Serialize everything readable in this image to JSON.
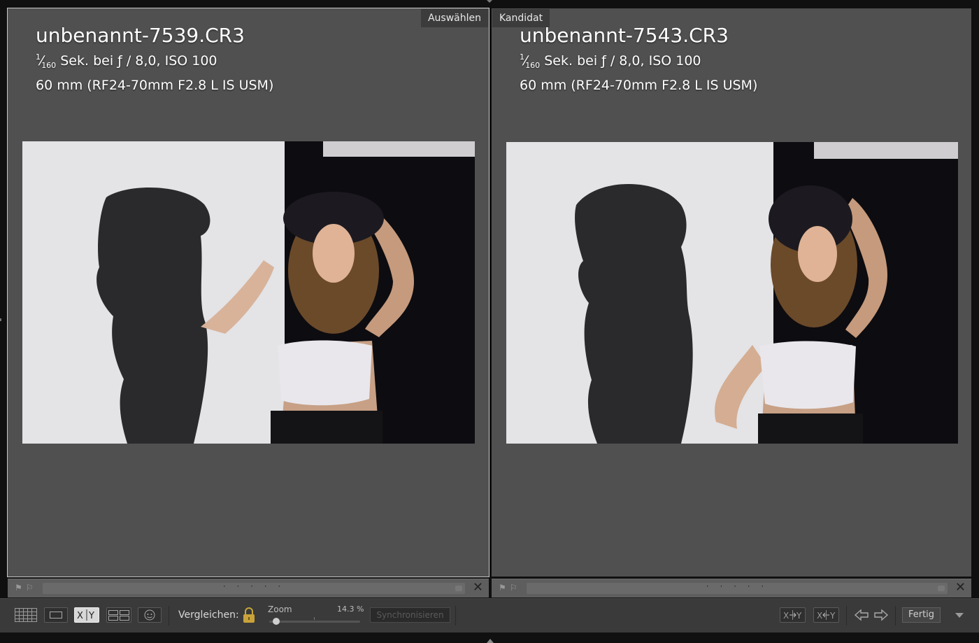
{
  "left_panel": {
    "tag": "Auswählen",
    "filename": "unbenannt-7539.CR3",
    "shutter_num": "1",
    "shutter_den": "160",
    "exposure_rest": "Sek. bei ƒ / 8,0, ISO 100",
    "lens": "60 mm (RF24-70mm F2.8 L IS USM)"
  },
  "right_panel": {
    "tag": "Kandidat",
    "filename": "unbenannt-7543.CR3",
    "shutter_num": "1",
    "shutter_den": "160",
    "exposure_rest": "Sek. bei ƒ / 8,0, ISO 100",
    "lens": "60 mm (RF24-70mm F2.8 L IS USM)"
  },
  "strip": {
    "dots": "· · · · ·",
    "close": "✕"
  },
  "toolbar": {
    "compare_label": "Vergleichen:",
    "zoom_label": "Zoom",
    "zoom_value": "14.3 %",
    "sync_label": "Synchronisieren",
    "done_label": "Fertig",
    "xy_label": "X|Y",
    "swap_label": "X↔Y",
    "make_select_label": "X|Y"
  },
  "icons": {
    "grid": "grid-icon",
    "loupe": "loupe-icon",
    "compare": "compare-icon",
    "survey": "survey-icon",
    "people": "people-icon",
    "lock": "lock-icon",
    "prev": "arrow-left-icon",
    "next": "arrow-right-icon"
  },
  "colors": {
    "panel_bg": "#505050",
    "toolbar_bg": "#3a3a3a",
    "tag_bg": "#3c3c3c"
  }
}
